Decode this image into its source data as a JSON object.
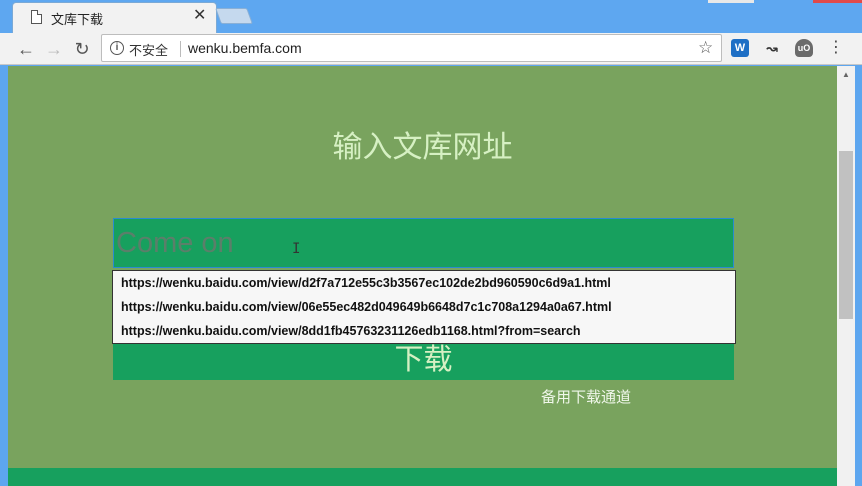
{
  "browser": {
    "tab_title": "文库下载",
    "close_glyph": "✕",
    "security_label": "不安全",
    "url": "wenku.bemfa.com",
    "ext_w_label": "W",
    "ext_ub_label": "uO"
  },
  "page": {
    "heading": "输入文库网址",
    "input_placeholder": "Come on",
    "suggestions": [
      "https://wenku.baidu.com/view/d2f7a712e55c3b3567ec102de2bd960590c6d9a1.html",
      "https://wenku.baidu.com/view/06e55ec482d049649b6648d7c1c708a1294a0a67.html",
      "https://wenku.baidu.com/view/8dd1fb45763231126edb1168.html?from=search"
    ],
    "download_label": "下载",
    "backup_link": "备用下载通道"
  },
  "colors": {
    "page_bg": "#79a35e",
    "accent_green": "#17a05e",
    "heading_text": "#d6f0c3",
    "chrome_blue": "#5da6ef"
  },
  "icons": {
    "tab": "document-icon",
    "back": "arrow-left-icon",
    "forward": "arrow-right-icon",
    "reload": "reload-icon",
    "info": "info-icon",
    "bookmark": "star-icon",
    "menu": "kebab-menu-icon"
  }
}
